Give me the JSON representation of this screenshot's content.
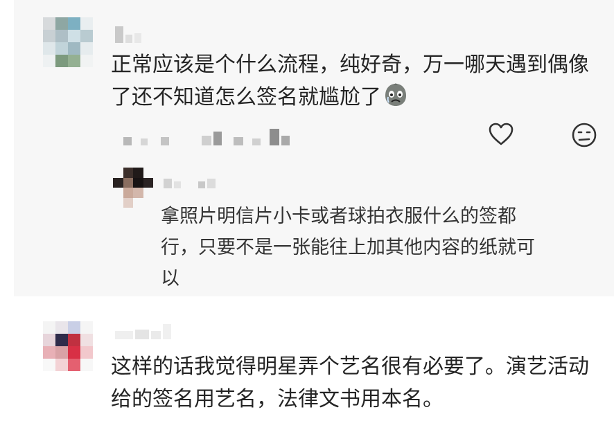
{
  "comments": [
    {
      "text_lines": [
        "正常应该是个什么流程，纯好奇，万一哪天遇到偶像",
        "了还不知道怎么签名就尴尬了"
      ],
      "emoji_icon": "crying-face-emoji-icon",
      "actions": {
        "like_icon": "heart-icon",
        "dislike_icon": "frown-face-icon"
      },
      "reply": {
        "text_lines": [
          "拿照片明信片小卡或者球拍衣服什么的签都",
          "行，只要不是一张能往上加其他内容的纸就可",
          "以"
        ]
      }
    },
    {
      "text_lines": [
        "这样的话我觉得明星弄个艺名很有必要了。演艺活动",
        "给的签名用艺名，法律文书用本名。"
      ]
    }
  ],
  "colors": {
    "panel_bg": "#f7f7f7",
    "text": "#242424",
    "icon": "#333333"
  }
}
